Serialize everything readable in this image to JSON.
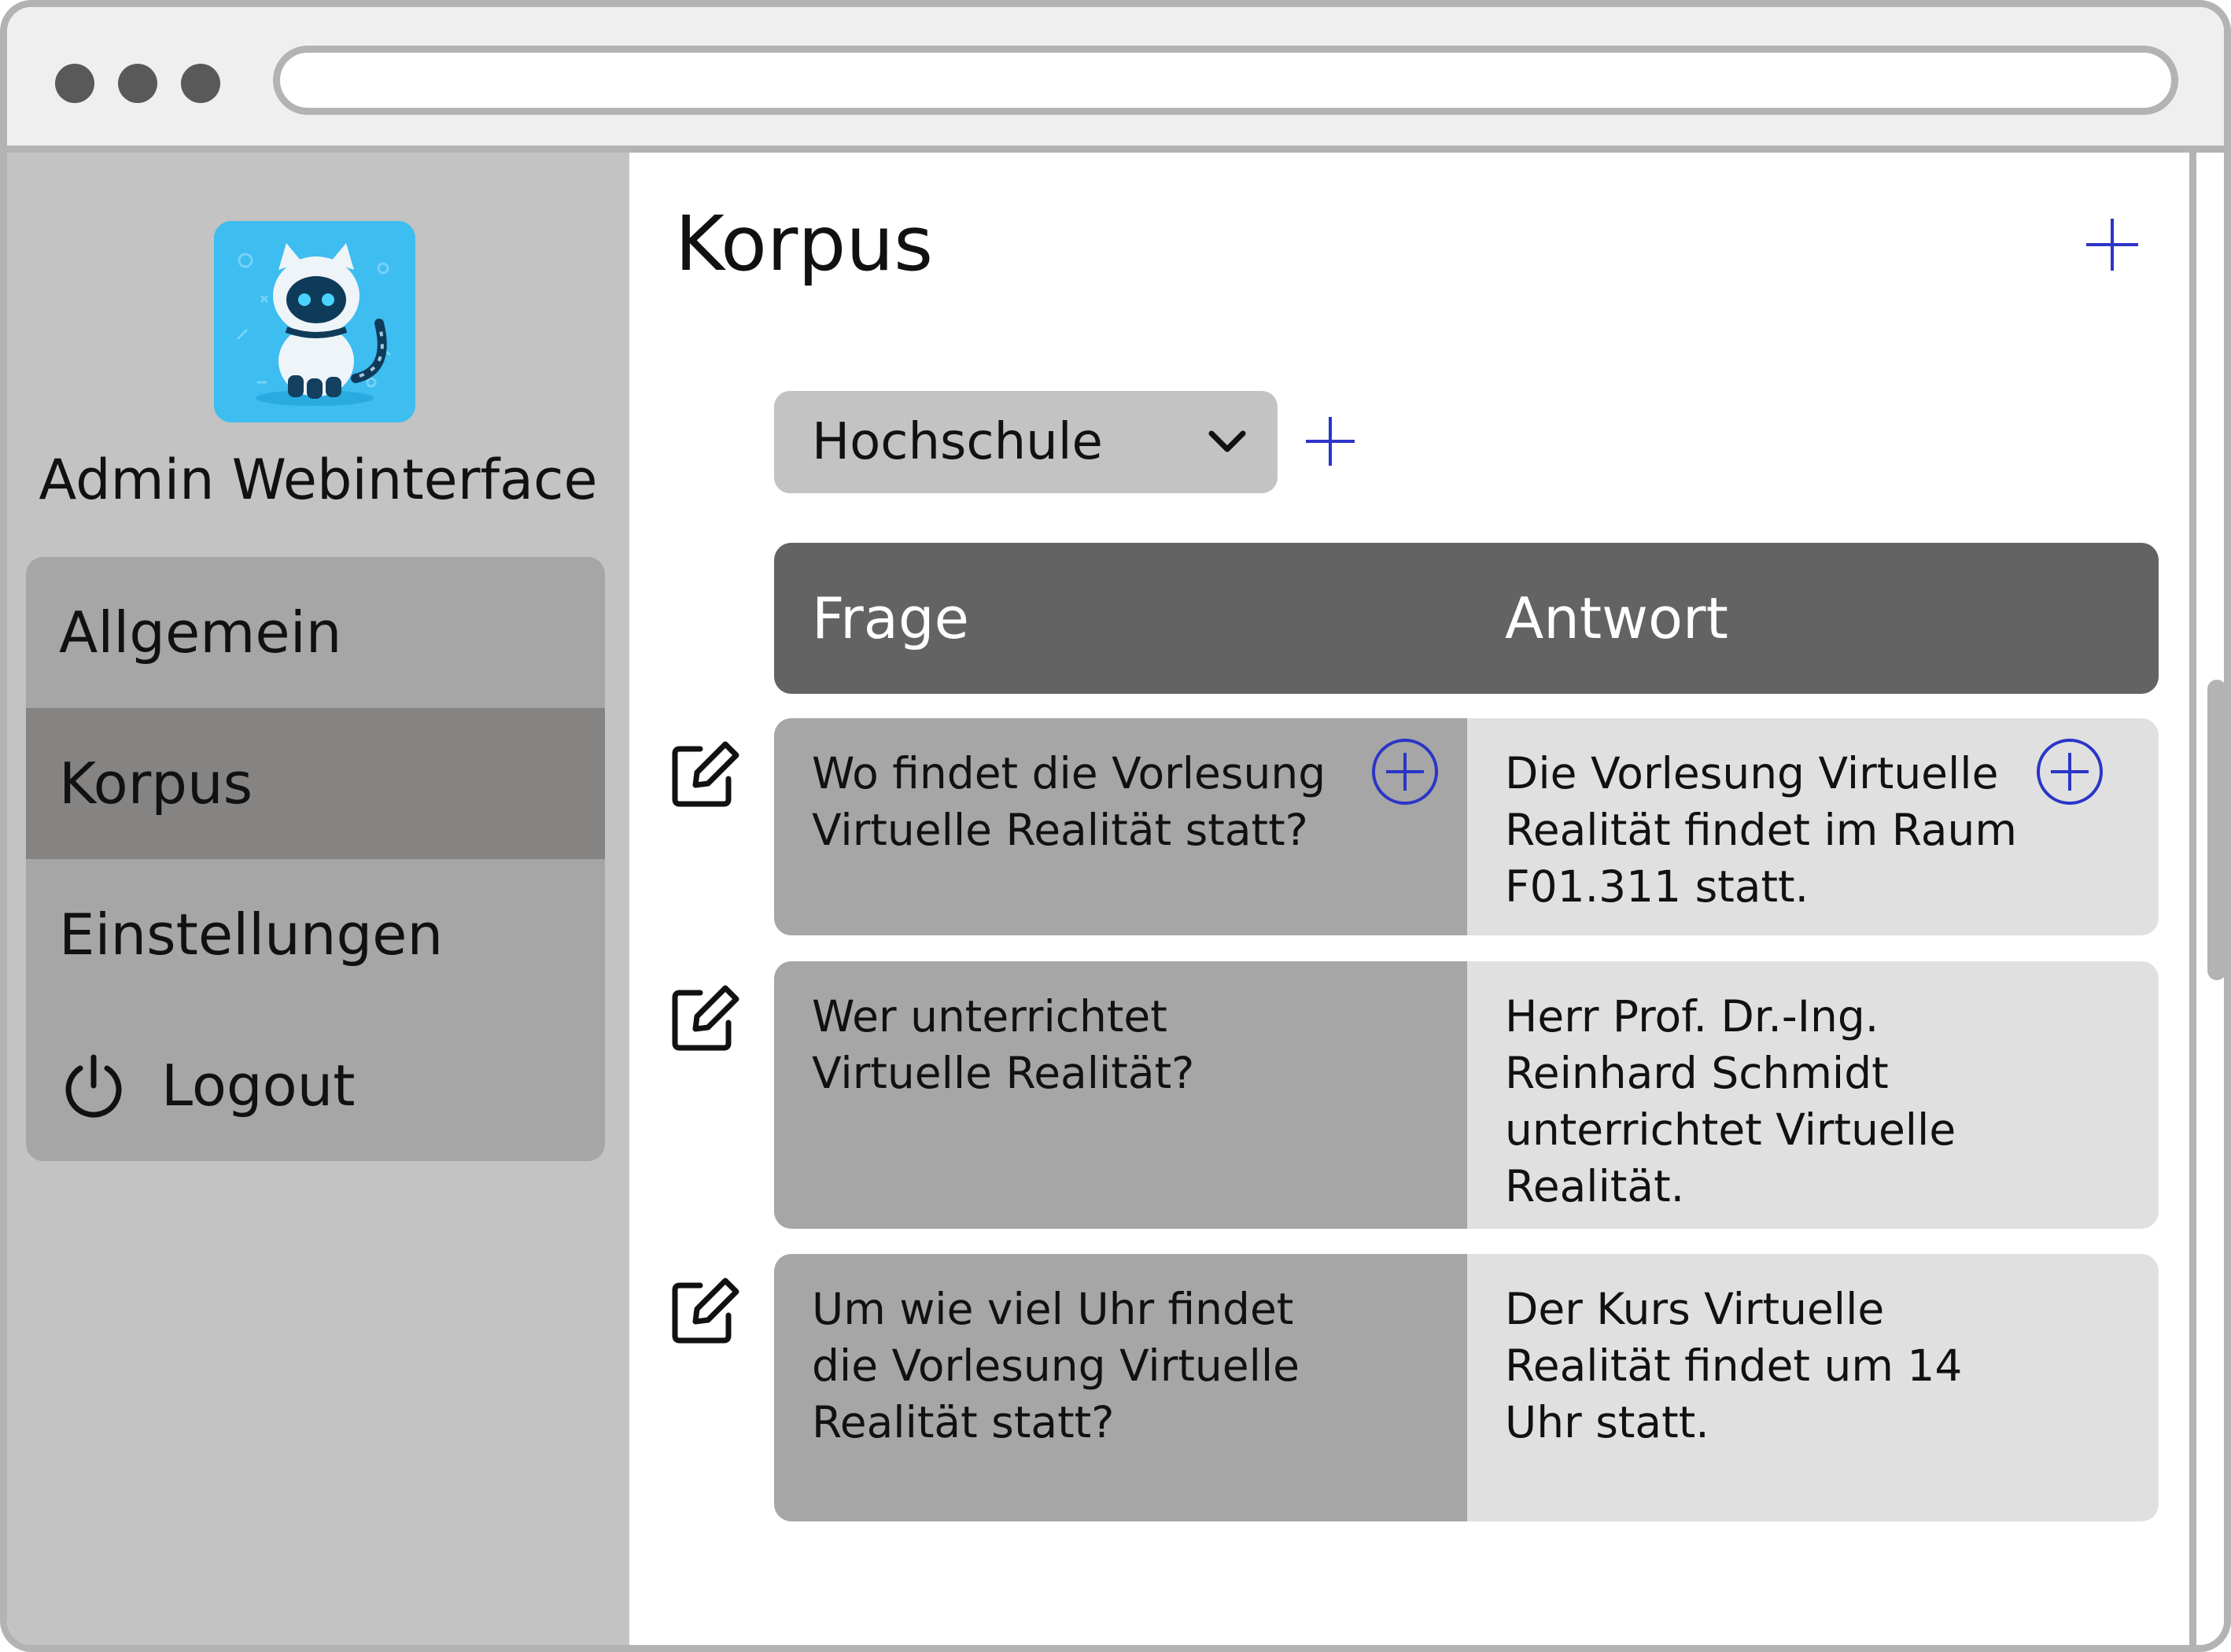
{
  "sidebar": {
    "app_title": "Admin Webinterface",
    "logo_icon": "robot-cat-logo",
    "menu": [
      {
        "label": "Allgemein",
        "active": false
      },
      {
        "label": "Korpus",
        "active": true
      },
      {
        "label": "Einstellungen",
        "active": false
      },
      {
        "label": "Logout",
        "icon": "power-icon",
        "active": false
      }
    ]
  },
  "main": {
    "title": "Korpus",
    "category": {
      "selected": "Hochschule"
    },
    "table": {
      "headers": {
        "question": "Frage",
        "answer": "Antwort"
      },
      "rows": [
        {
          "question": "Wo findet die Vorlesung Virtuelle Realität statt?",
          "answer": "Die Vorlesung Virtuelle Realität findet im Raum F01.311 statt."
        },
        {
          "question": "Wer unterrichtet Virtuelle Realität?",
          "answer": "Herr Prof. Dr.-Ing. Reinhard Schmidt unterrichtet Virtuelle Realität."
        },
        {
          "question": "Um wie viel Uhr findet die Vorlesung Virtuelle Realität statt?",
          "answer": "Der Kurs Virtuelle Realität findet um 14 Uhr statt."
        }
      ]
    }
  },
  "colors": {
    "accent_blue": "#2b35c7",
    "header_bg": "#636363",
    "sidebar_bg": "#c3c3c3",
    "active_menu_bg": "#868383"
  }
}
